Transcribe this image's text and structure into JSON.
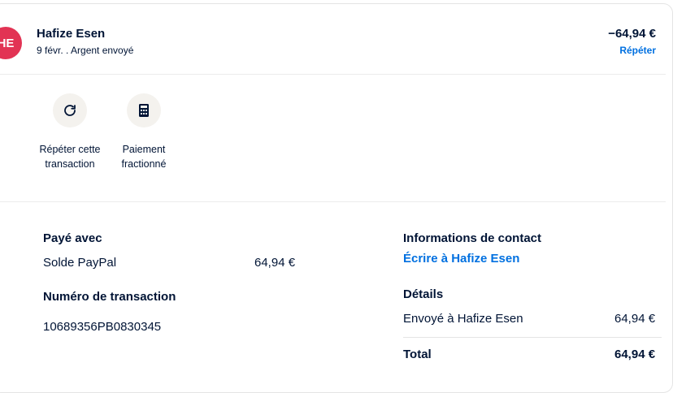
{
  "header": {
    "avatar_initials": "HE",
    "name": "Hafize Esen",
    "subtitle": "9 févr. . Argent envoyé",
    "amount": "−64,94 €",
    "repeat_link": "Répéter"
  },
  "actions": [
    {
      "label": "Répéter cette transaction",
      "icon": "refresh-icon"
    },
    {
      "label": "Paiement fractionné",
      "icon": "calculator-icon"
    }
  ],
  "payment": {
    "paid_with_heading": "Payé avec",
    "method": "Solde PayPal",
    "method_amount": "64,94 €",
    "transaction_heading": "Numéro de transaction",
    "transaction_id": "10689356PB0830345"
  },
  "contact": {
    "heading": "Informations de contact",
    "write_link": "Écrire à Hafize Esen"
  },
  "details": {
    "heading": "Détails",
    "sent_label": "Envoyé à Hafize Esen",
    "sent_amount": "64,94 €",
    "total_label": "Total",
    "total_amount": "64,94 €"
  },
  "colors": {
    "avatar": "#e23354",
    "link": "#0070e0",
    "text": "#001435",
    "icon_bg": "#f4f2ee"
  }
}
